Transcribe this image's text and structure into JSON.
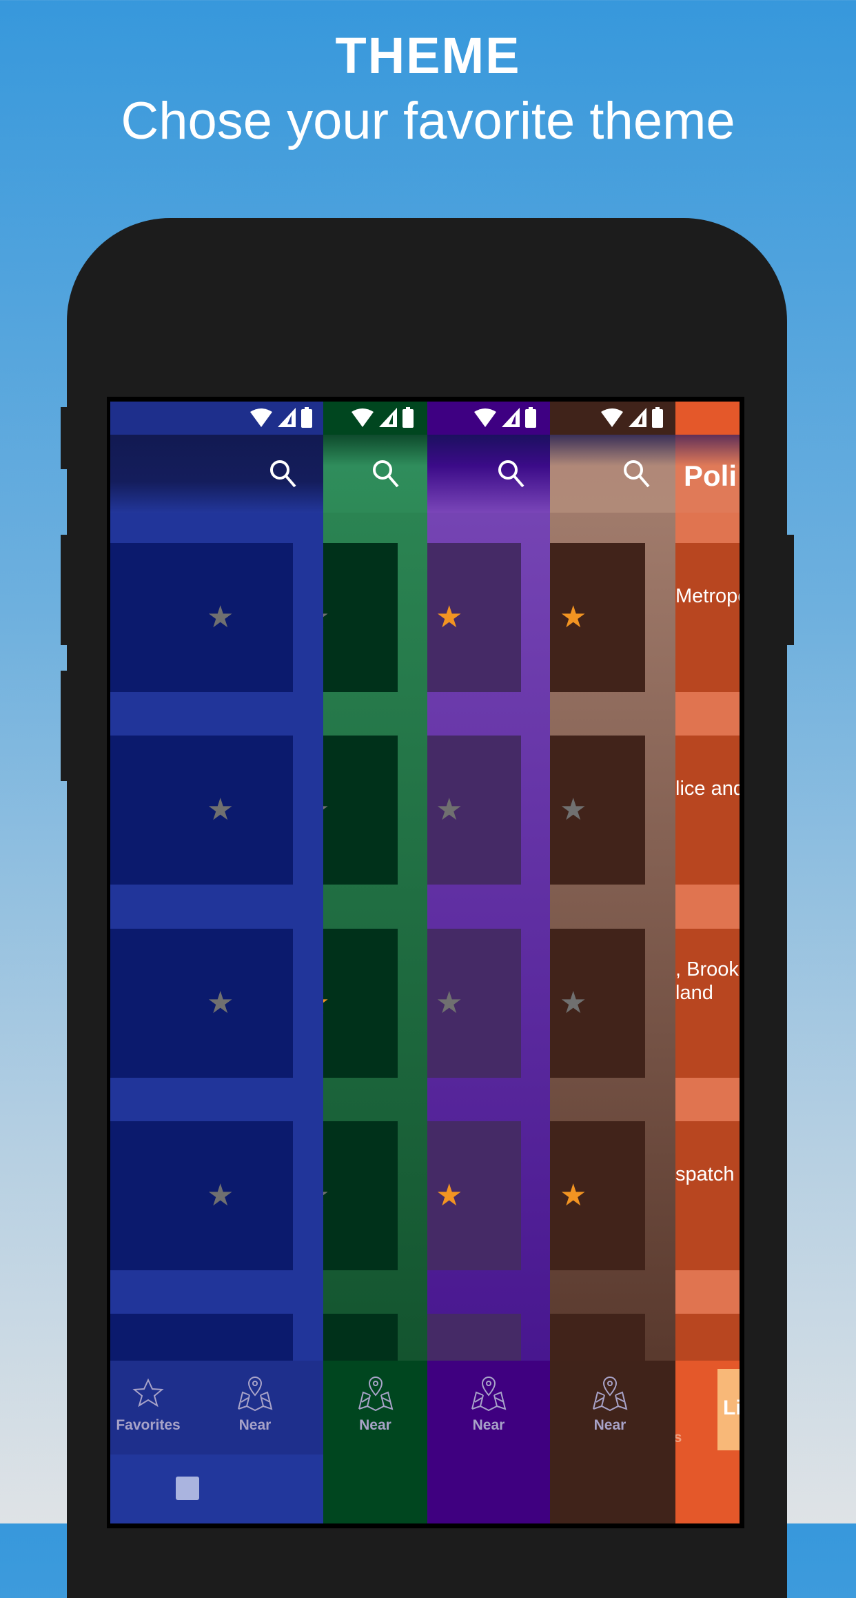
{
  "header": {
    "title": "THEME",
    "subtitle": "Chose your favorite theme"
  },
  "themes": [
    {
      "name": "blue",
      "status": "#1e2f8c",
      "toolbar": "linear-gradient(#121a52,#141d5c 60%,#22369a)",
      "bg": "#21359a",
      "card": "#0b1a6d",
      "stars": [
        "gray",
        "gray",
        "gray",
        "gray"
      ],
      "nav": "#1e2f8c",
      "navbar": "#22379c"
    },
    {
      "name": "green",
      "status": "#00461f",
      "toolbar": "linear-gradient(#0e4a2c,#2f8d5c 40%,#2e8a57)",
      "bg": "linear-gradient(#2e8a57,#0f4b28)",
      "card": "#00311a",
      "stars": [
        "gray",
        "gray",
        "orange",
        "gray"
      ],
      "nav": "#00461f",
      "navbar": "#00461f"
    },
    {
      "name": "purple",
      "status": "#3e0082",
      "toolbar": "linear-gradient(#1c1060,#3b0b88 40%,#7a46b8)",
      "bg": "linear-gradient(#7b4ab8,#3f0e88)",
      "card": "#452a66",
      "stars": [
        "orange",
        "gray",
        "gray",
        "orange"
      ],
      "nav": "#3f0080",
      "navbar": "#3f0080"
    },
    {
      "name": "brown",
      "status": "#40231a",
      "toolbar": "linear-gradient(#3a3058,#b08878 40%,#b08a78)",
      "bg": "linear-gradient(#a98373,#4c2d22)",
      "card": "#41231a",
      "stars": [
        "orange",
        "gray",
        "gray",
        "orange"
      ],
      "nav": "#40231a",
      "navbar": "#40231a"
    },
    {
      "name": "orange",
      "status": "#e4582a",
      "toolbar": "linear-gradient(#603058,#e07a58 40%,#e07a58)",
      "bg": "#e07450",
      "card": "#b84620",
      "stars": [],
      "nav": "#e4582a",
      "navbar": "#e4582a"
    }
  ],
  "colors": {
    "star_gray": "#707070",
    "star_orange": "#f29422"
  },
  "orange_column": {
    "toolbar_title": "Poli",
    "rows": [
      "Metropo",
      "lice and",
      ", Brookl\nland",
      "spatch -"
    ],
    "nav_partial": "es",
    "nav_button": "Li"
  },
  "nav": {
    "favorites": "Favorites",
    "near": "Near"
  },
  "icons": [
    "wifi-icon",
    "signal-icon",
    "battery-icon",
    "search-icon",
    "star-icon",
    "map-pin-icon",
    "home-square-icon"
  ]
}
